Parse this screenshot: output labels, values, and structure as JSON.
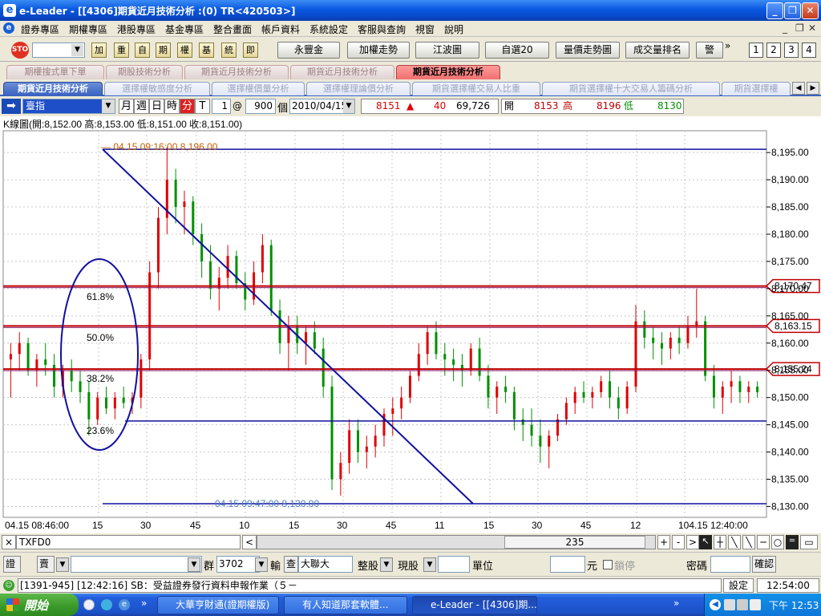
{
  "window": {
    "title": "e-Leader - [[4306]期貨近月技術分析 :(0) TR<420503>]",
    "min_label": "_",
    "restore_label": "❐",
    "close_label": "✕"
  },
  "menu": {
    "items": [
      "證券專區",
      "期權專區",
      "港股專區",
      "基金專區",
      "整合畫面",
      "帳戶資料",
      "系統設定",
      "客服與查詢",
      "視窗",
      "說明"
    ],
    "mdi_controls": [
      "_",
      "❐",
      "✕"
    ]
  },
  "toolbar": {
    "small_buttons": [
      "加",
      "重",
      "自",
      "期",
      "權",
      "基",
      "統",
      "即"
    ],
    "buttons": [
      "永豐金",
      "加權走勢",
      "江波圖",
      "自選20",
      "量價走勢圖",
      "成交量排名",
      "警"
    ],
    "overflow": "»",
    "number_buttons": [
      "1",
      "2",
      "3",
      "4"
    ]
  },
  "tabs_row1": [
    "期權搜式單下單",
    "期股技術分析",
    "期貨近月技術分析",
    "期貨近月技術分析",
    "期貨近月技術分析"
  ],
  "tabs_row2": [
    "期貨近月技術分析",
    "選擇權敏感度分析",
    "選擇權價量分析",
    "選擇權理論價分析",
    "期貨選擇權交易人比重",
    "期貨選擇權十大交易人籌碼分析",
    "期貨選擇權"
  ],
  "quote": {
    "symbol": "臺指",
    "periods": [
      "月",
      "週",
      "日",
      "時",
      "分",
      "T"
    ],
    "period_count": "1",
    "at_sign": "@",
    "bars": "900",
    "bars_unit": "個",
    "date": "2010/04/15",
    "last": "8151",
    "change_arrow": "▲",
    "change": "40",
    "volume": "69,726",
    "open_label": "開",
    "open": "8153",
    "high_label": "高",
    "high": "8196",
    "low_label": "低",
    "low": "8130"
  },
  "chart_data": {
    "type": "candlestick",
    "title": "K線圖(開:8,152.00 高:8,153.00 低:8,151.00 收:8,151.00)",
    "ylim": [
      8128,
      8199
    ],
    "y_ticks": [
      "8,195.00",
      "8,190.00",
      "8,185.00",
      "8,180.00",
      "8,175.00",
      "8,170.00",
      "8,165.00",
      "8,160.00",
      "8,155.00",
      "8,150.00",
      "8,145.00",
      "8,140.00",
      "8,135.00",
      "8,130.00"
    ],
    "y_values": [
      8195,
      8190,
      8185,
      8180,
      8175,
      8170,
      8165,
      8160,
      8155,
      8150,
      8145,
      8140,
      8135,
      8130
    ],
    "x_labels": [
      "04.15 08:46:00",
      "15",
      "30",
      "45",
      "10",
      "15",
      "30",
      "45",
      "11",
      "15",
      "30",
      "45",
      "12",
      "104.15 12:40:00"
    ],
    "annotation_high": "04.15 09:16:00  8,196.00",
    "annotation_low": "04.15 09:47:00  8,130.00",
    "fib_labels": [
      "61.8%",
      "50.0%",
      "38.2%",
      "23.6%"
    ],
    "price_tags": [
      "8,170.47",
      "8,163.15",
      "8,155.24"
    ],
    "price_tag_values": [
      8170.47,
      8163.15,
      8155.24
    ],
    "support_values": [
      8195.6,
      8145.7,
      8130.5
    ],
    "candles": [
      [
        8157,
        8160,
        8150,
        8158
      ],
      [
        8158,
        8162,
        8155,
        8160
      ],
      [
        8160,
        8161,
        8154,
        8155
      ],
      [
        8155,
        8158,
        8152,
        8157
      ],
      [
        8157,
        8160,
        8154,
        8156
      ],
      [
        8156,
        8158,
        8150,
        8152
      ],
      [
        8152,
        8156,
        8150,
        8155
      ],
      [
        8155,
        8157,
        8151,
        8153
      ],
      [
        8153,
        8155,
        8149,
        8151
      ],
      [
        8151,
        8153,
        8143,
        8146
      ],
      [
        8146,
        8151,
        8145,
        8150
      ],
      [
        8150,
        8152,
        8147,
        8148
      ],
      [
        8148,
        8151,
        8146,
        8150
      ],
      [
        8150,
        8152,
        8148,
        8149
      ],
      [
        8149,
        8151,
        8147,
        8150
      ],
      [
        8150,
        8158,
        8148,
        8157
      ],
      [
        8157,
        8175,
        8155,
        8173
      ],
      [
        8173,
        8185,
        8170,
        8183
      ],
      [
        8183,
        8196,
        8180,
        8190
      ],
      [
        8190,
        8192,
        8182,
        8185
      ],
      [
        8185,
        8188,
        8180,
        8186
      ],
      [
        8186,
        8187,
        8178,
        8180
      ],
      [
        8180,
        8182,
        8172,
        8175
      ],
      [
        8175,
        8178,
        8168,
        8170
      ],
      [
        8170,
        8174,
        8166,
        8172
      ],
      [
        8172,
        8178,
        8170,
        8176
      ],
      [
        8176,
        8177,
        8170,
        8171
      ],
      [
        8171,
        8173,
        8166,
        8168
      ],
      [
        8168,
        8175,
        8167,
        8173
      ],
      [
        8173,
        8180,
        8171,
        8178
      ],
      [
        8178,
        8179,
        8165,
        8166
      ],
      [
        8166,
        8168,
        8158,
        8160
      ],
      [
        8160,
        8165,
        8155,
        8163
      ],
      [
        8163,
        8165,
        8158,
        8160
      ],
      [
        8160,
        8163,
        8156,
        8162
      ],
      [
        8162,
        8164,
        8158,
        8159
      ],
      [
        8159,
        8161,
        8150,
        8152
      ],
      [
        8152,
        8154,
        8133,
        8135
      ],
      [
        8135,
        8140,
        8132,
        8138
      ],
      [
        8138,
        8146,
        8136,
        8144
      ],
      [
        8144,
        8146,
        8138,
        8140
      ],
      [
        8140,
        8143,
        8137,
        8141
      ],
      [
        8141,
        8145,
        8139,
        8143
      ],
      [
        8143,
        8148,
        8141,
        8147
      ],
      [
        8147,
        8150,
        8143,
        8148
      ],
      [
        8148,
        8152,
        8146,
        8150
      ],
      [
        8150,
        8155,
        8149,
        8154
      ],
      [
        8154,
        8160,
        8153,
        8158
      ],
      [
        8158,
        8163,
        8156,
        8162
      ],
      [
        8162,
        8164,
        8157,
        8158
      ],
      [
        8158,
        8160,
        8154,
        8157
      ],
      [
        8157,
        8159,
        8153,
        8156
      ],
      [
        8156,
        8158,
        8152,
        8155
      ],
      [
        8155,
        8160,
        8154,
        8159
      ],
      [
        8159,
        8161,
        8153,
        8154
      ],
      [
        8154,
        8156,
        8148,
        8150
      ],
      [
        8150,
        8153,
        8147,
        8152
      ],
      [
        8152,
        8154,
        8149,
        8151
      ],
      [
        8151,
        8152,
        8144,
        8146
      ],
      [
        8146,
        8148,
        8142,
        8145
      ],
      [
        8145,
        8148,
        8141,
        8143
      ],
      [
        8143,
        8146,
        8138,
        8141
      ],
      [
        8141,
        8144,
        8137,
        8143
      ],
      [
        8143,
        8147,
        8142,
        8146
      ],
      [
        8146,
        8150,
        8145,
        8149
      ],
      [
        8149,
        8152,
        8147,
        8151
      ],
      [
        8151,
        8153,
        8149,
        8150
      ],
      [
        8150,
        8152,
        8148,
        8151
      ],
      [
        8151,
        8154,
        8150,
        8153
      ],
      [
        8153,
        8155,
        8148,
        8150
      ],
      [
        8150,
        8152,
        8146,
        8148
      ],
      [
        8148,
        8153,
        8147,
        8152
      ],
      [
        8152,
        8167,
        8151,
        8164
      ],
      [
        8164,
        8166,
        8159,
        8161
      ],
      [
        8161,
        8163,
        8157,
        8160
      ],
      [
        8160,
        8162,
        8156,
        8159
      ],
      [
        8159,
        8162,
        8157,
        8161
      ],
      [
        8161,
        8163,
        8158,
        8160
      ],
      [
        8160,
        8165,
        8159,
        8163
      ],
      [
        8163,
        8170,
        8161,
        8164
      ],
      [
        8164,
        8165,
        8153,
        8154
      ],
      [
        8154,
        8156,
        8148,
        8150
      ],
      [
        8150,
        8153,
        8147,
        8152
      ],
      [
        8152,
        8155,
        8149,
        8153
      ],
      [
        8153,
        8154,
        8149,
        8151
      ],
      [
        8151,
        8153,
        8149,
        8152
      ],
      [
        8152,
        8153,
        8150,
        8151
      ]
    ]
  },
  "scrollbar": {
    "close": "×",
    "symbol": "TXFD0",
    "left_arrow": "<",
    "value": "235",
    "tool_buttons": [
      "+",
      "-",
      ">"
    ]
  },
  "order": {
    "type1": "證",
    "side": "賣",
    "group_label": "群",
    "code": "3702",
    "input_label": "輸",
    "lookup_label": "查",
    "stock_name": "大聯大",
    "lot_label": "整股",
    "price_type": "現股",
    "unit_label": "單位",
    "price_unit": "元",
    "lock_label": "鎖停",
    "password_label": "密碼",
    "confirm_label": "確認"
  },
  "news": {
    "text": "[1391-945] [12:42:16] SB：受益證券發行資料申報作業（５－",
    "settings_label": "設定",
    "clock": "12:54:00"
  },
  "taskbar": {
    "start_label": "開始",
    "tasks": [
      "大華亨財通(證期權版)",
      "有人知道那套軟體...",
      "e-Leader - [[4306]期..."
    ],
    "overflow": "»",
    "clock": "下午 12:53"
  }
}
